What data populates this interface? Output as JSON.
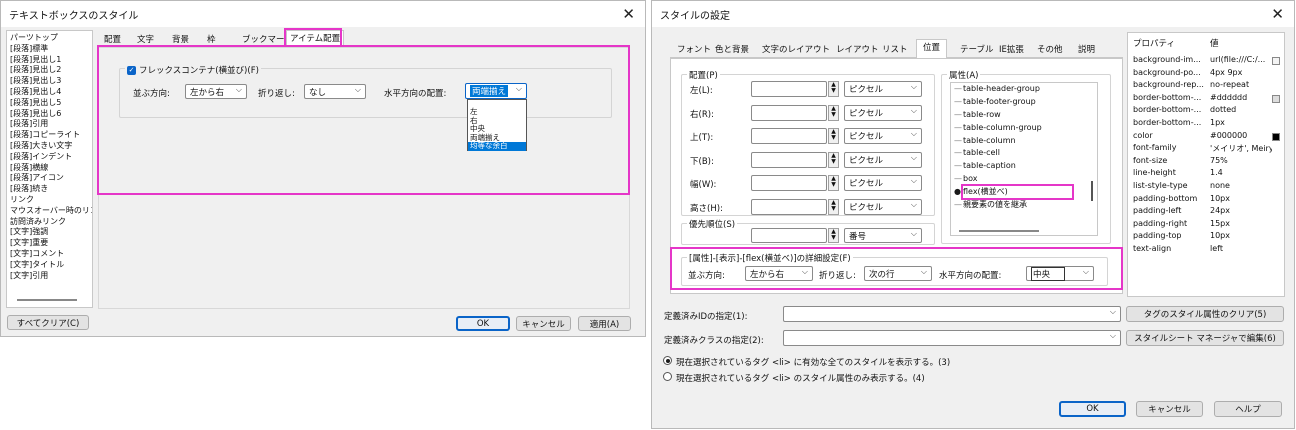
{
  "left": {
    "title": "テキストボックスのスタイル",
    "style_list": [
      "パーツトップ",
      "[段落]標準",
      "[段落]見出し1",
      "[段落]見出し2",
      "[段落]見出し3",
      "[段落]見出し4",
      "[段落]見出し5",
      "[段落]見出し6",
      "[段落]引用",
      "[段落]コピーライト",
      "[段落]大きい文字",
      "[段落]インデント",
      "[段落]横線",
      "[段落]アイコン",
      "[段落]続き",
      "リンク",
      "マウスオーバー時のリン",
      "訪問済みリンク",
      "[文字]強調",
      "[文字]重要",
      "[文字]コメント",
      "[文字]タイトル",
      "[文字]引用"
    ],
    "tabs": [
      "配置",
      "文字",
      "背景",
      "枠",
      "ブックマーク",
      "アイテム配置"
    ],
    "active_tab": "アイテム配置",
    "flex_checkbox": "フレックスコンテナ(横並び)(F)",
    "direction_label": "並ぶ方向:",
    "direction_value": "左から右",
    "wrap_label": "折り返し:",
    "wrap_value": "なし",
    "halign_label": "水平方向の配置:",
    "halign_value": "両端揃え",
    "halign_options": [
      "左",
      "右",
      "中央",
      "両端揃え",
      "均等な余白"
    ],
    "halign_options_selected": "均等な余白",
    "clear_all": "すべてクリア(C)",
    "ok": "OK",
    "cancel": "キャンセル",
    "apply": "適用(A)"
  },
  "right": {
    "title": "スタイルの設定",
    "tabs": [
      "フォント",
      "色と背景",
      "文字のレイアウト",
      "レイアウト",
      "リスト",
      "位置",
      "テーブル",
      "IE拡張",
      "その他",
      "説明"
    ],
    "active_tab": "位置",
    "layout_group": "配置(P)",
    "unit": "ピクセル",
    "pos_rows": [
      "左(L):",
      "右(R):",
      "上(T):",
      "下(B):",
      "幅(W):",
      "高さ(H):"
    ],
    "priority_group": "優先順位(S)",
    "priority_unit": "番号",
    "attr_group": "属性(A)",
    "attr_items": [
      "table-header-group",
      "table-footer-group",
      "table-row",
      "table-column-group",
      "table-column",
      "table-cell",
      "table-caption",
      "box",
      "flex(横並べ)",
      "親要素の値を継承"
    ],
    "attr_selected": "flex(横並べ)",
    "detail_group": "[属性]-[表示]-[flex(横並べ)]の詳細設定(F)",
    "direction_label": "並ぶ方向:",
    "direction_value": "左から右",
    "wrap_label": "折り返し:",
    "wrap_value": "次の行",
    "halign_label": "水平方向の配置:",
    "halign_value": "中央",
    "prop_header": [
      "プロパティ",
      "値"
    ],
    "props": [
      [
        "background-im...",
        "url(file:///C:/..."
      ],
      [
        "background-po...",
        "4px 9px"
      ],
      [
        "background-rep...",
        "no-repeat"
      ],
      [
        "border-bottom-...",
        "#dddddd"
      ],
      [
        "border-bottom-...",
        "dotted"
      ],
      [
        "border-bottom-...",
        "1px"
      ],
      [
        "color",
        "#000000"
      ],
      [
        "font-family",
        "'メイリオ', Meiry..."
      ],
      [
        "font-size",
        "75%"
      ],
      [
        "line-height",
        "1.4"
      ],
      [
        "list-style-type",
        "none"
      ],
      [
        "padding-bottom",
        "10px"
      ],
      [
        "padding-left",
        "24px"
      ],
      [
        "padding-right",
        "15px"
      ],
      [
        "padding-top",
        "10px"
      ],
      [
        "text-align",
        "left"
      ]
    ],
    "id_label": "定義済みIDの指定(1):",
    "class_label": "定義済みクラスの指定(2):",
    "clear_btn": "タグのスタイル属性のクリア(5)",
    "manager_btn": "スタイルシート マネージャで編集(6)",
    "radio1": "現在選択されているタグ <li> に有効な全てのスタイルを表示する。(3)",
    "radio2": "現在選択されているタグ <li> のスタイル属性のみ表示する。(4)",
    "ok": "OK",
    "cancel": "キャンセル",
    "help": "ヘルプ"
  },
  "colors": {
    "highlight": "#e536c8",
    "accent": "#0a64c8",
    "selection": "#0078d7"
  }
}
